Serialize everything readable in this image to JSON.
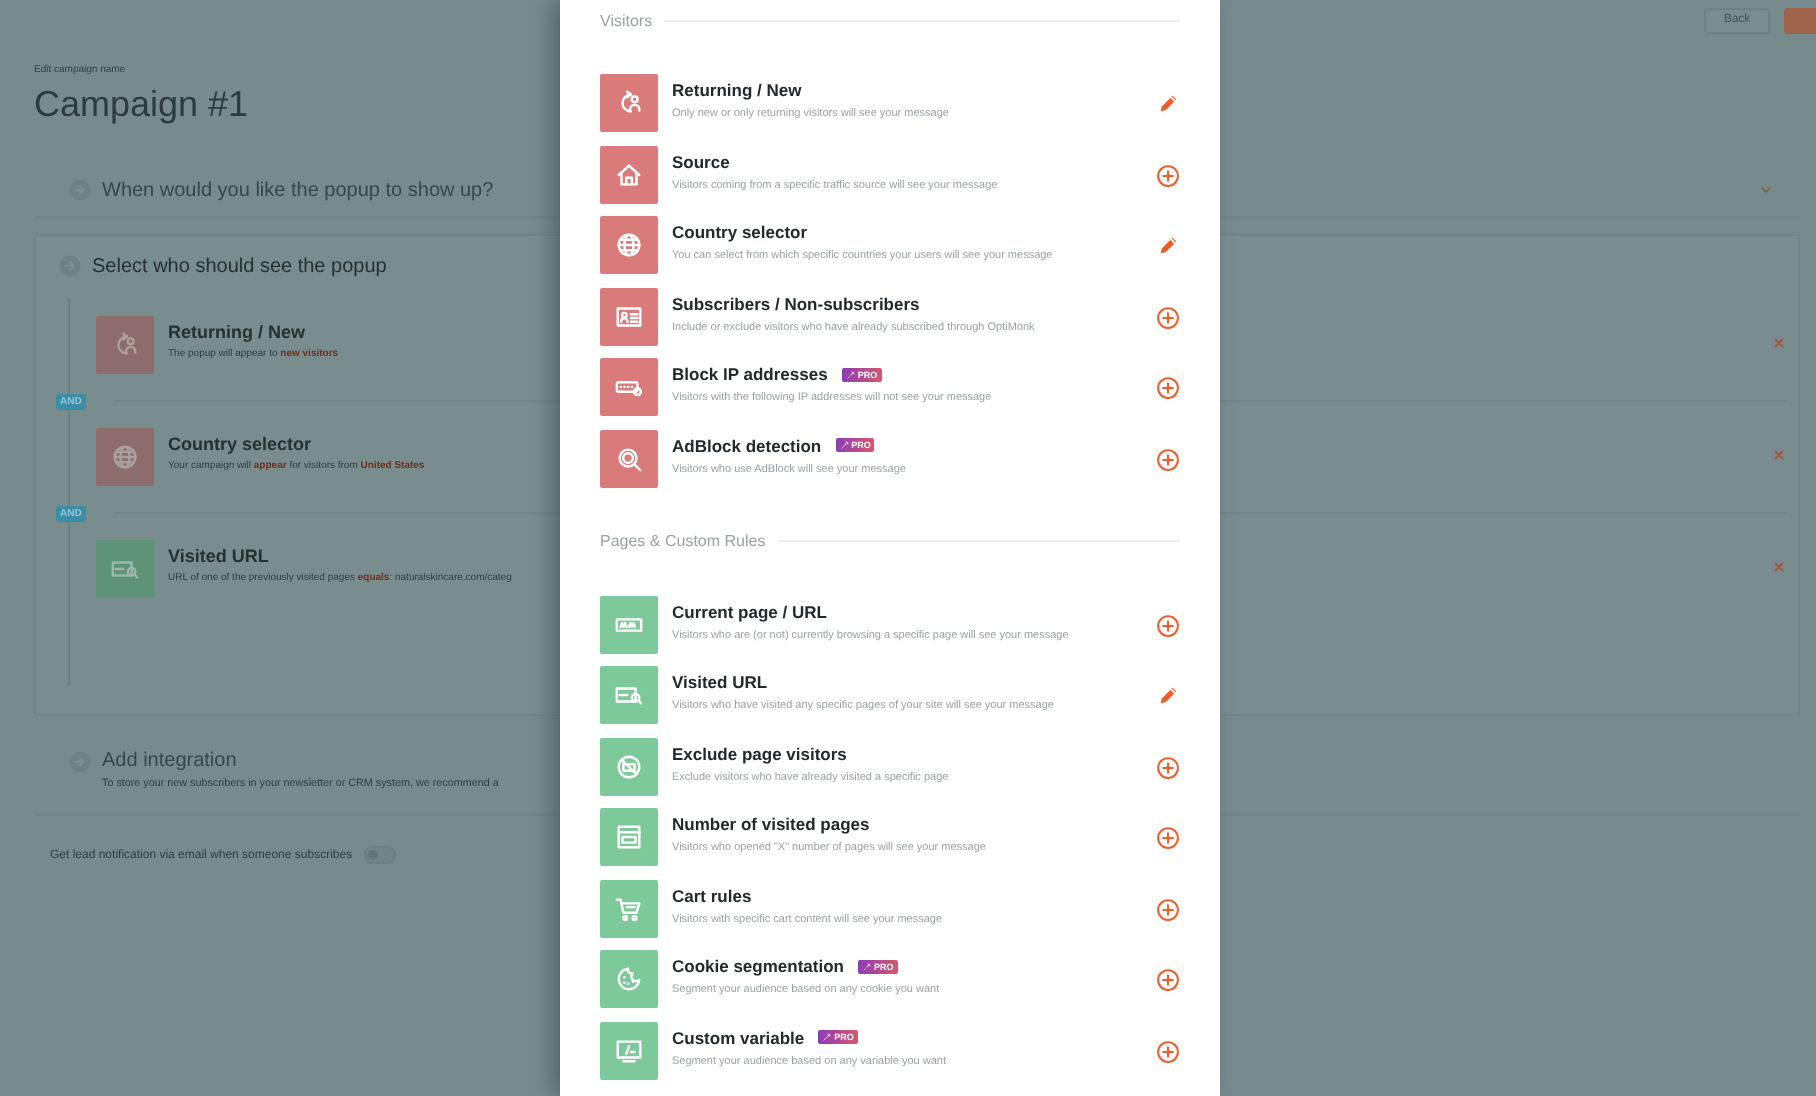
{
  "page": {
    "back_button": "Back",
    "name_label": "Edit campaign name",
    "title": "Campaign #1",
    "steps": [
      {
        "kind": "collapsed",
        "title": "When would you like the popup to show up?"
      },
      {
        "kind": "open",
        "title": "Select who should see the popup",
        "rules": [
          {
            "kind": "visitors",
            "title": "Returning / New",
            "description": "The popup will appear to **new visitors**"
          },
          {
            "kind": "visitors",
            "joiner": "AND",
            "title": "Country selector",
            "description": "Your campaign will **appear** for visitors from **United States**"
          },
          {
            "kind": "pages",
            "joiner": "AND",
            "title": "Visited URL",
            "description": "URL of one of the previously visited pages **equals**: naturalskincare.com/categ"
          }
        ]
      },
      {
        "kind": "info",
        "title": "Add integration",
        "description": "To store your new subscribers in your newsletter or CRM system, we recommend a"
      }
    ],
    "notification": {
      "label": "Get lead notification via email when someone subscribes",
      "on": false
    }
  },
  "modal": {
    "sections": [
      {
        "kind": "visitors",
        "title": "Visitors",
        "items": [
          {
            "kind": "edit",
            "title": "Returning / New",
            "description": "Only new or only returning visitors will see your message"
          },
          {
            "kind": "add",
            "title": "Source",
            "description": "Visitors coming from a specific traffic source will see your message"
          },
          {
            "kind": "edit",
            "title": "Country selector",
            "description": "You can select from which specific countries your users will see your message"
          },
          {
            "kind": "add",
            "title": "Subscribers / Non-subscribers",
            "description": "Include or exclude visitors who have already subscribed through OptiMonk"
          },
          {
            "kind": "add",
            "title": "Block IP addresses",
            "pro_badge": "PRO",
            "description": "Visitors with the following IP addresses will not see your message"
          },
          {
            "kind": "add",
            "title": "AdBlock detection",
            "pro_badge": "PRO",
            "description": "Visitors who use AdBlock will see your message"
          }
        ]
      },
      {
        "kind": "pages",
        "title": "Pages & Custom Rules",
        "items": [
          {
            "kind": "add",
            "title": "Current page / URL",
            "description": "Visitors who are (or not) currently browsing a specific page will see your message"
          },
          {
            "kind": "edit",
            "title": "Visited URL",
            "description": "Visitors who have visited any specific pages of your site will see your message"
          },
          {
            "kind": "add",
            "title": "Exclude page visitors",
            "description": "Exclude visitors who have already visited a specific page"
          },
          {
            "kind": "add",
            "title": "Number of visited pages",
            "description": "Visitors who opened \"X\" number of pages will see your message"
          },
          {
            "kind": "add",
            "title": "Cart rules",
            "description": "Visitors with specific cart content will see your message"
          },
          {
            "kind": "add",
            "title": "Cookie segmentation",
            "pro_badge": "PRO",
            "description": "Segment your audience based on any cookie you want"
          },
          {
            "kind": "add",
            "title": "Custom variable",
            "pro_badge": "PRO",
            "description": "Segment your audience based on any variable you want"
          }
        ]
      }
    ]
  }
}
